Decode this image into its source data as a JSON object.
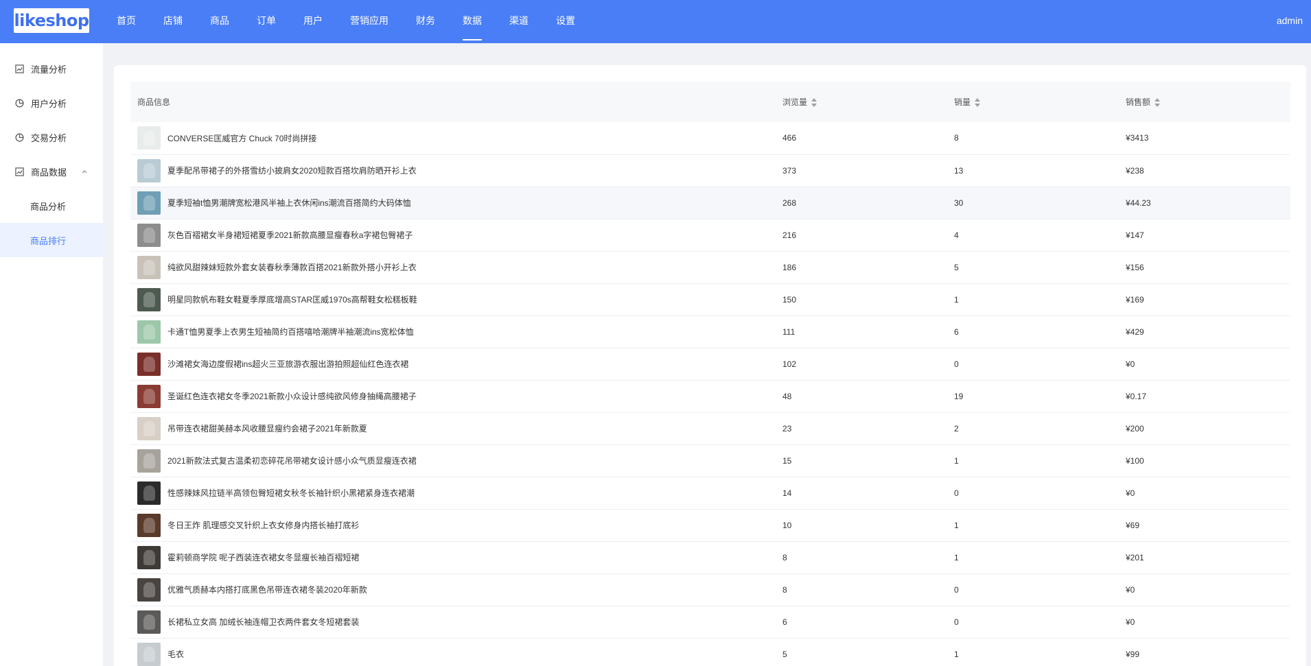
{
  "header": {
    "logo": "likeshop",
    "nav": [
      "首页",
      "店铺",
      "商品",
      "订单",
      "用户",
      "营销应用",
      "财务",
      "数据",
      "渠道",
      "设置"
    ],
    "active_nav": "数据",
    "user": "admin"
  },
  "sidebar": {
    "items": [
      {
        "label": "流量分析",
        "icon": "line-chart-icon"
      },
      {
        "label": "用户分析",
        "icon": "pie-chart-icon"
      },
      {
        "label": "交易分析",
        "icon": "pie-chart-icon"
      },
      {
        "label": "商品数据",
        "icon": "line-chart-icon",
        "expanded": true
      }
    ],
    "subitems": [
      {
        "label": "商品分析",
        "active": false
      },
      {
        "label": "商品排行",
        "active": true
      }
    ]
  },
  "table": {
    "headers": {
      "goods": "商品信息",
      "views": "浏览量",
      "sales": "销量",
      "amount": "销售额"
    },
    "rows": [
      {
        "name": "CONVERSE匡威官方 Chuck 70时尚拼接",
        "views": "466",
        "sales": "8",
        "amount": "¥3413",
        "thumb_color": "#e8ecea"
      },
      {
        "name": "夏季配吊带裙子的外搭雪纺小披肩女2020短款百搭坎肩防晒开衫上衣",
        "views": "373",
        "sales": "13",
        "amount": "¥238",
        "thumb_color": "#b9cbd4"
      },
      {
        "name": "夏季短袖t恤男潮牌宽松港风半袖上衣休闲ins潮流百搭简约大码体恤",
        "views": "268",
        "sales": "30",
        "amount": "¥44.23",
        "thumb_color": "#6f9fb5",
        "highlight": true
      },
      {
        "name": "灰色百褶裙女半身裙短裙夏季2021新款高腰显瘦春秋a字裙包臀裙子",
        "views": "216",
        "sales": "4",
        "amount": "¥147",
        "thumb_color": "#8d8d8d"
      },
      {
        "name": "纯欲风甜辣妹短款外套女装春秋季薄款百搭2021新款外搭小开衫上衣",
        "views": "186",
        "sales": "5",
        "amount": "¥156",
        "thumb_color": "#c9c2b8"
      },
      {
        "name": "明星同款帆布鞋女鞋夏季厚底增高STAR匡威1970s高帮鞋女松糕板鞋",
        "views": "150",
        "sales": "1",
        "amount": "¥169",
        "thumb_color": "#4d5a4f"
      },
      {
        "name": "卡通T恤男夏季上衣男生短袖简约百搭嘻哈潮牌半袖潮流ins宽松体恤",
        "views": "111",
        "sales": "6",
        "amount": "¥429",
        "thumb_color": "#9cc7a8"
      },
      {
        "name": "沙滩裙女海边度假裙ins超火三亚旅游衣服出游拍照超仙红色连衣裙",
        "views": "102",
        "sales": "0",
        "amount": "¥0",
        "thumb_color": "#7a2f2a"
      },
      {
        "name": "圣诞红色连衣裙女冬季2021新款小众设计感纯欲风修身抽绳高腰裙子",
        "views": "48",
        "sales": "19",
        "amount": "¥0.17",
        "thumb_color": "#8a3b33"
      },
      {
        "name": "吊带连衣裙甜美赫本风收腰显瘦约会裙子2021年新款夏",
        "views": "23",
        "sales": "2",
        "amount": "¥200",
        "thumb_color": "#d8cfc6"
      },
      {
        "name": "2021新款法式复古温柔初恋碎花吊带裙女设计感小众气质显瘦连衣裙",
        "views": "15",
        "sales": "1",
        "amount": "¥100",
        "thumb_color": "#a7a29b"
      },
      {
        "name": "性感辣妹风拉链半高领包臀短裙女秋冬长袖针织小黑裙紧身连衣裙潮",
        "views": "14",
        "sales": "0",
        "amount": "¥0",
        "thumb_color": "#2b2b2b"
      },
      {
        "name": "冬日王炸 肌理感交叉针织上衣女修身内搭长袖打底衫",
        "views": "10",
        "sales": "1",
        "amount": "¥69",
        "thumb_color": "#5a3a2a"
      },
      {
        "name": "霍莉顿商学院 呢子西装连衣裙女冬显瘦长袖百褶短裙",
        "views": "8",
        "sales": "1",
        "amount": "¥201",
        "thumb_color": "#3e3a36"
      },
      {
        "name": "优雅气质赫本内搭打底黑色吊带连衣裙冬装2020年新款",
        "views": "8",
        "sales": "0",
        "amount": "¥0",
        "thumb_color": "#4a4440"
      },
      {
        "name": "长裙私立女高 加绒长袖连帽卫衣两件套女冬短裙套装",
        "views": "6",
        "sales": "0",
        "amount": "¥0",
        "thumb_color": "#5c5a58"
      },
      {
        "name": "毛衣",
        "views": "5",
        "sales": "1",
        "amount": "¥99",
        "thumb_color": "#c6ccd0"
      }
    ]
  },
  "colors": {
    "primary": "#4a7ef6",
    "page_bg": "#f0f2f5",
    "header_row": "#f7f8fa",
    "active_sub_bg": "#ecf2ff"
  }
}
